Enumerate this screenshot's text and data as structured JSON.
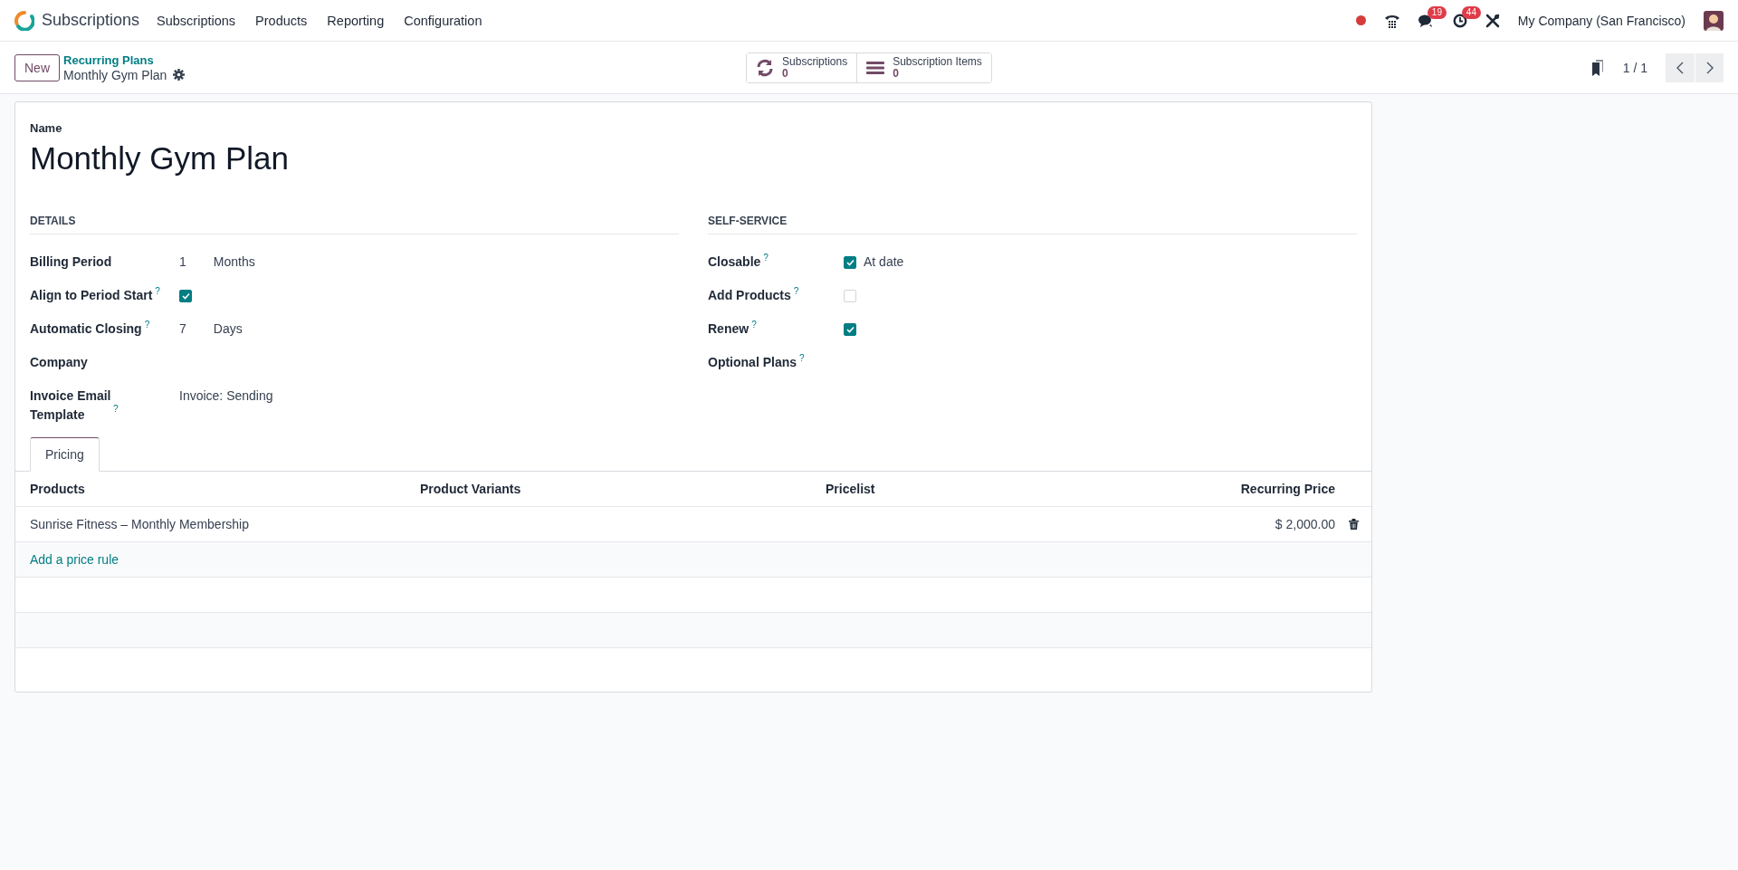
{
  "navbar": {
    "app_name": "Subscriptions",
    "menu": [
      "Subscriptions",
      "Products",
      "Reporting",
      "Configuration"
    ],
    "messages_badge": "19",
    "activities_badge": "44",
    "company": "My Company (San Francisco)"
  },
  "control_panel": {
    "new_button": "New",
    "breadcrumb": "Recurring Plans",
    "record_title": "Monthly Gym Plan",
    "smart_buttons": [
      {
        "kind": "refresh",
        "label": "Subscriptions",
        "value": "0"
      },
      {
        "kind": "list",
        "label": "Subscription Items",
        "value": "0"
      }
    ],
    "pager": "1 / 1"
  },
  "form": {
    "name_label": "Name",
    "name": "Monthly Gym Plan",
    "groups": [
      {
        "title": "DETAILS",
        "fields": [
          {
            "kind": "number_unit",
            "label": "Billing Period",
            "value": "1",
            "unit": "Months"
          },
          {
            "kind": "checkbox",
            "label": "Align to Period Start",
            "help": "?",
            "checked": true
          },
          {
            "kind": "number_unit",
            "label": "Automatic Closing",
            "help": "?",
            "value": "7",
            "unit": "Days"
          },
          {
            "kind": "empty",
            "label": "Company"
          },
          {
            "kind": "text",
            "label": "Invoice Email Template",
            "help": "?",
            "value": "Invoice: Sending"
          }
        ]
      },
      {
        "title": "SELF-SERVICE",
        "fields": [
          {
            "kind": "checkbox",
            "label": "Closable",
            "help": "?",
            "checked": true,
            "text": "At date"
          },
          {
            "kind": "checkbox",
            "label": "Add Products",
            "help": "?",
            "checked": false
          },
          {
            "kind": "checkbox",
            "label": "Renew",
            "help": "?",
            "checked": true
          },
          {
            "kind": "empty",
            "label": "Optional Plans",
            "help": "?"
          }
        ]
      }
    ],
    "tabs": [
      {
        "label": "Pricing",
        "selected": true
      }
    ],
    "table": {
      "columns": [
        "Products",
        "Product Variants",
        "Pricelist",
        "Recurring Price"
      ],
      "rows": [
        {
          "product": "Sunrise Fitness – Monthly Membership",
          "recurring_price": "$ 2,000.00"
        }
      ],
      "add_link": "Add a price rule"
    }
  }
}
